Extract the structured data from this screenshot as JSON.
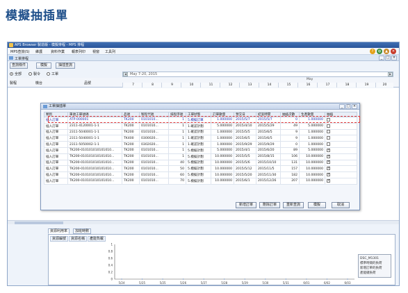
{
  "page_title": "模擬抽插單",
  "window": {
    "title": "APS Browser 製造版 - 模擬排程 - MPS 排程",
    "document_tab": "工單排程",
    "system_icons": [
      "help-icon",
      "globe-icon",
      "lock-icon",
      "exit-icon"
    ]
  },
  "menu": [
    "MPS查詢(S)",
    "維護",
    "資料作業",
    "報表列印",
    "視窗",
    "工具列"
  ],
  "toolbar": {
    "buttons": [
      "查詢條件",
      "模擬",
      "抽插查詢"
    ]
  },
  "filters": {
    "options": [
      "全部",
      "製令",
      "工單"
    ],
    "selected_index": 0,
    "date_range": "May 7-20, 2015"
  },
  "grid_header": {
    "left_labels": [
      "製程",
      "機台",
      "品號"
    ],
    "month": "May",
    "days": [
      "7",
      "8",
      "9",
      "10",
      "11",
      "12",
      "13",
      "14",
      "15",
      "16",
      "17",
      "18",
      "19",
      "20"
    ]
  },
  "dialog": {
    "title": "工單抽插單",
    "columns": [
      "類別",
      "單號工單號碼",
      "品號",
      "製程代號",
      "排程序號",
      "工單狀態",
      "訂單數量",
      "預交日",
      "結案時間",
      "抽插次數",
      "生產數量",
      "抽插"
    ],
    "rows": [
      {
        "type": "插入訂單",
        "order": "ATP-000001",
        "item": "TK200",
        "route": "0101010...",
        "seq": "1",
        "status": "5.模擬訂單",
        "qty": "1.000000",
        "due": "2015/5/7",
        "close": "2015/5/7",
        "count": "0",
        "prod": "1.000000",
        "checked": false
      },
      {
        "type": "插入訂單",
        "order": "2311-4120001-1-1",
        "item": "TK200",
        "route": "0101010...",
        "seq": "1",
        "status": "1.確認計劃",
        "qty": "5.000000",
        "due": "2015/4/10",
        "close": "2015/5/29",
        "count": "49",
        "prod": "5.000000",
        "checked": false
      },
      {
        "type": "插入訂單",
        "order": "2311-5040001-1-1",
        "item": "TK200",
        "route": "0101010...",
        "seq": "1",
        "status": "1.確認計劃",
        "qty": "1.000000",
        "due": "2015/5/5",
        "close": "2015/6/5",
        "count": "9",
        "prod": "1.000000",
        "checked": false
      },
      {
        "type": "插入訂單",
        "order": "2311-5040001-1-1",
        "item": "TK400",
        "route": "0300020...",
        "seq": "1",
        "status": "1.確認計劃",
        "qty": "1.000000",
        "due": "2015/6/5",
        "close": "2015/6/5",
        "count": "9",
        "prod": "1.000000",
        "checked": false
      },
      {
        "type": "插入訂單",
        "order": "2311-5050002-1-1",
        "item": "TK200",
        "route": "0302020...",
        "seq": "1",
        "status": "1.確認計劃",
        "qty": "1.000000",
        "due": "2015/9/29",
        "close": "2015/9/29",
        "count": "0",
        "prod": "1.000000",
        "checked": false
      },
      {
        "type": "插入訂單",
        "order": "TK200-010101010101010...",
        "item": "TK200",
        "route": "0101010...",
        "seq": "1",
        "status": "5.模擬計劃",
        "qty": "5.000000",
        "due": "2015/4/1",
        "close": "2015/6/20",
        "count": "89",
        "prod": "5.000000",
        "checked": true
      },
      {
        "type": "插入訂單",
        "order": "TK200-010101010101010...",
        "item": "TK200",
        "route": "0101010...",
        "seq": "1",
        "status": "5.模擬計劃",
        "qty": "10.000000",
        "due": "2015/5/5",
        "close": "2015/8/15",
        "count": "106",
        "prod": "10.000000",
        "checked": true
      },
      {
        "type": "插入訂單",
        "order": "TK200-010101010101010...",
        "item": "TK200",
        "route": "0101010...",
        "seq": "40",
        "status": "5.模擬計劃",
        "qty": "10.000000",
        "due": "2015/5/6",
        "close": "2015/10/10",
        "count": "131",
        "prod": "10.000000",
        "checked": true
      },
      {
        "type": "插入訂單",
        "order": "TK200-010101010101010...",
        "item": "TK200",
        "route": "0101010...",
        "seq": "50",
        "status": "5.模擬計劃",
        "qty": "10.000000",
        "due": "2015/5/12",
        "close": "2015/11/5",
        "count": "157",
        "prod": "10.000000",
        "checked": true
      },
      {
        "type": "插入訂單",
        "order": "TK200-010101010101010...",
        "item": "TK200",
        "route": "0101010...",
        "seq": "60",
        "status": "5.模擬計劃",
        "qty": "10.000000",
        "due": "2015/5/20",
        "close": "2015/11/30",
        "count": "182",
        "prod": "10.000000",
        "checked": true
      },
      {
        "type": "插入訂單",
        "order": "TK200-010101010101010...",
        "item": "TK200",
        "route": "0101010...",
        "seq": "70",
        "status": "5.模擬計劃",
        "qty": "10.000000",
        "due": "2015/6/1",
        "close": "2015/12/26",
        "count": "207",
        "prod": "10.000000",
        "checked": true
      }
    ],
    "buttons": [
      "新增訂單",
      "刪除訂單",
      "重新查詢",
      "模擬",
      "取消"
    ]
  },
  "bottom": {
    "tabs": [
      "資源利用率",
      "加班時數"
    ],
    "header_cells": [
      "資源編號",
      "資源名稱",
      "產能負載"
    ],
    "legend": [
      "DSC_M1301",
      "標準時間的負荷",
      "新增訂單的負荷",
      "產能總負荷"
    ]
  },
  "chart_data": {
    "type": "area",
    "categories": [
      "5/24",
      "5/25",
      "5/25",
      "5/26",
      "5/27",
      "5/28",
      "5/29",
      "5/30",
      "5/31",
      "6/01",
      "6/02",
      "6/03"
    ],
    "y_ticks": [
      "0",
      "0.2",
      "0.4",
      "0.6",
      "0.8",
      "1"
    ],
    "ylim": [
      0,
      1
    ],
    "series": [
      {
        "values": [
          0,
          0,
          0,
          0,
          0,
          0,
          0,
          0,
          0,
          0,
          0,
          0
        ]
      }
    ],
    "legend_position": "right"
  }
}
